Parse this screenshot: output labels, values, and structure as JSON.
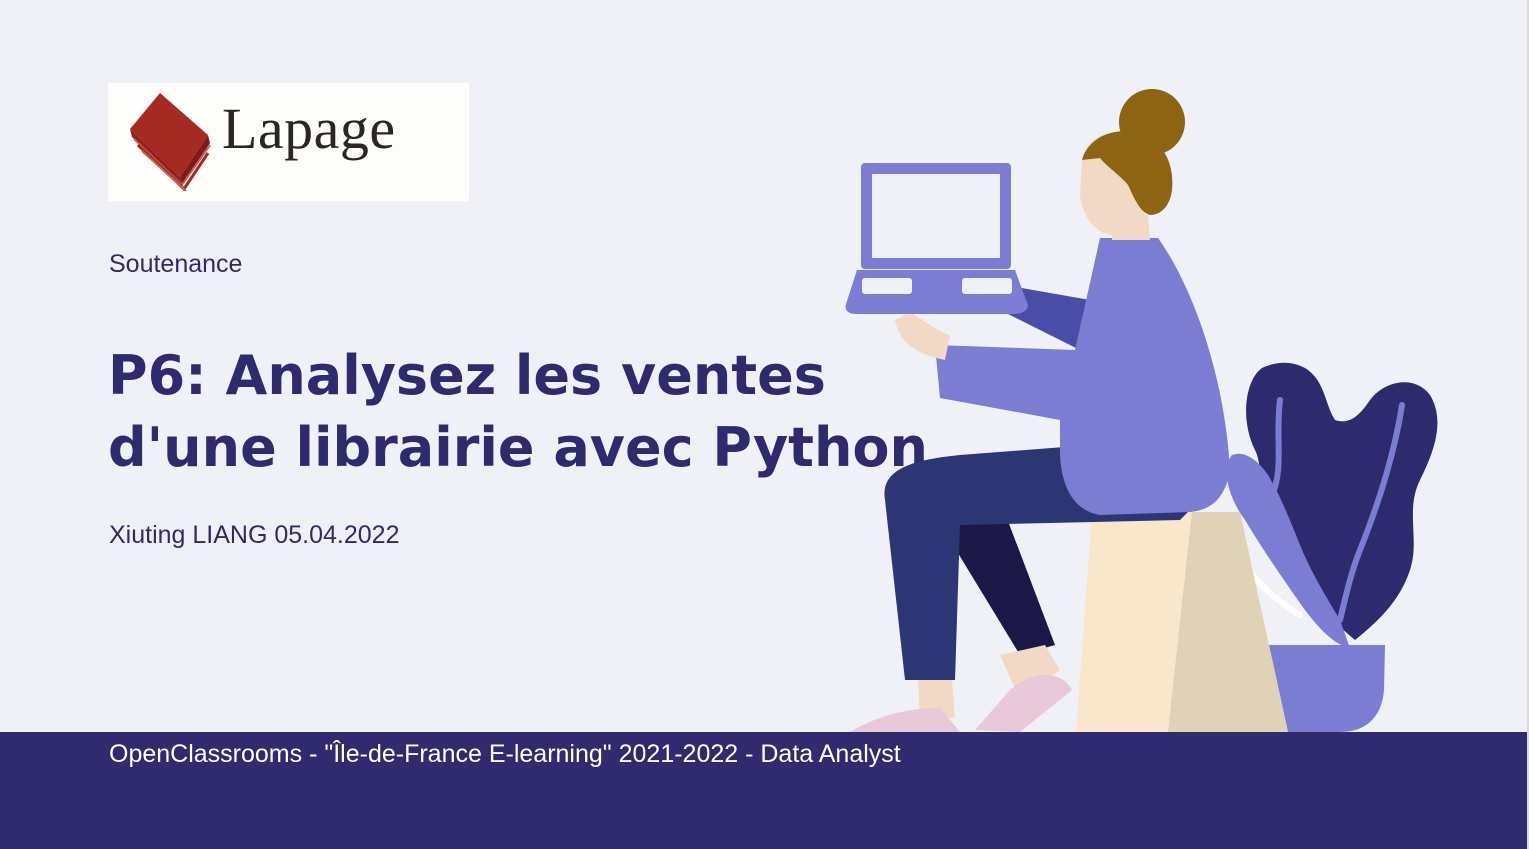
{
  "logo": {
    "text": "Lapage",
    "icon": "book-icon",
    "color": "#a52a21"
  },
  "slide": {
    "subtitle": "Soutenance",
    "title_line1": "P6: Analysez les ventes",
    "title_line2": "d'une librairie avec Python",
    "author": "Xiuting LIANG 05.04.2022"
  },
  "footer": {
    "text": "OpenClassrooms - \"Île-de-France E-learning\" 2021-2022 - Data Analyst"
  },
  "colors": {
    "background": "#f0f1f6",
    "text_primary": "#2d2a6e",
    "footer_bg": "#302a6f",
    "accent_purple": "#7a7dd2"
  }
}
